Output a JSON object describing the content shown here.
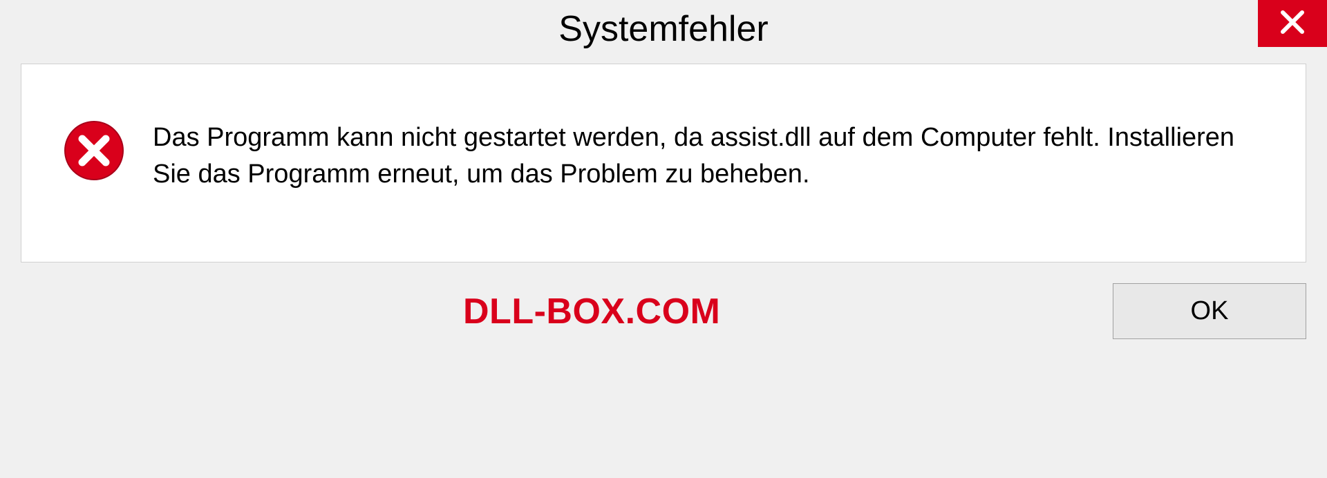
{
  "dialog": {
    "title": "Systemfehler",
    "message": "Das Programm kann nicht gestartet werden, da assist.dll auf dem Computer fehlt. Installieren Sie das Programm erneut, um das Problem zu beheben.",
    "ok_label": "OK"
  },
  "watermark": "DLL-BOX.COM",
  "colors": {
    "close_bg": "#d9001b",
    "watermark": "#d9001b"
  }
}
